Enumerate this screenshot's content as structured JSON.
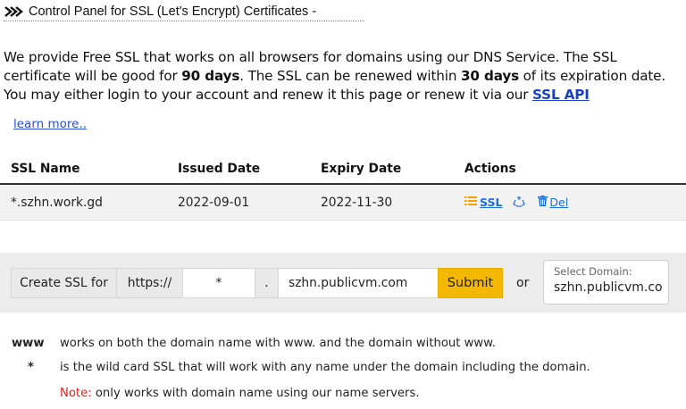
{
  "panel": {
    "title": "Control Panel for SSL (Let's Encrypt) Certificates -",
    "icon": "double-chevron-right-icon"
  },
  "intro": {
    "part1": "We provide Free SSL that works on all browsers for domains using our DNS Service. The SSL certificate will be good for ",
    "days_valid": "90 days",
    "part2": ". The SSL can be renewed within ",
    "renew_window": "30 days",
    "part3": " of its expiration date. You may either login to your account and renew it this page or renew it via our ",
    "api_link": "SSL API"
  },
  "learn_more": "learn more..",
  "table": {
    "headers": [
      "SSL Name",
      "Issued Date",
      "Expiry Date",
      "Actions"
    ],
    "rows": [
      {
        "name": "*.szhn.work.gd",
        "issued": "2022-09-01",
        "expiry": "2022-11-30",
        "action_ssl": "SSL",
        "action_del": "Del"
      }
    ]
  },
  "create": {
    "label": "Create SSL for",
    "protocol": "https://",
    "subdomain_value": "*",
    "dot": ".",
    "domain_value": "szhn.publicvm.com",
    "submit_label": "Submit",
    "or_text": "or",
    "select_label": "Select Domain:",
    "select_value": "szhn.publicvm.co"
  },
  "notes": {
    "www_key": "www",
    "www_text": "works on both the domain name with www. and the domain without www.",
    "star_key": "*",
    "star_text": "is the wild card SSL that will work with any name under the domain including the domain.",
    "note_label": "Note:",
    "note_text": " only works with domain name using our name servers."
  },
  "colors": {
    "link": "#1a3fc7",
    "submit": "#f5b800",
    "note": "#e02020"
  }
}
